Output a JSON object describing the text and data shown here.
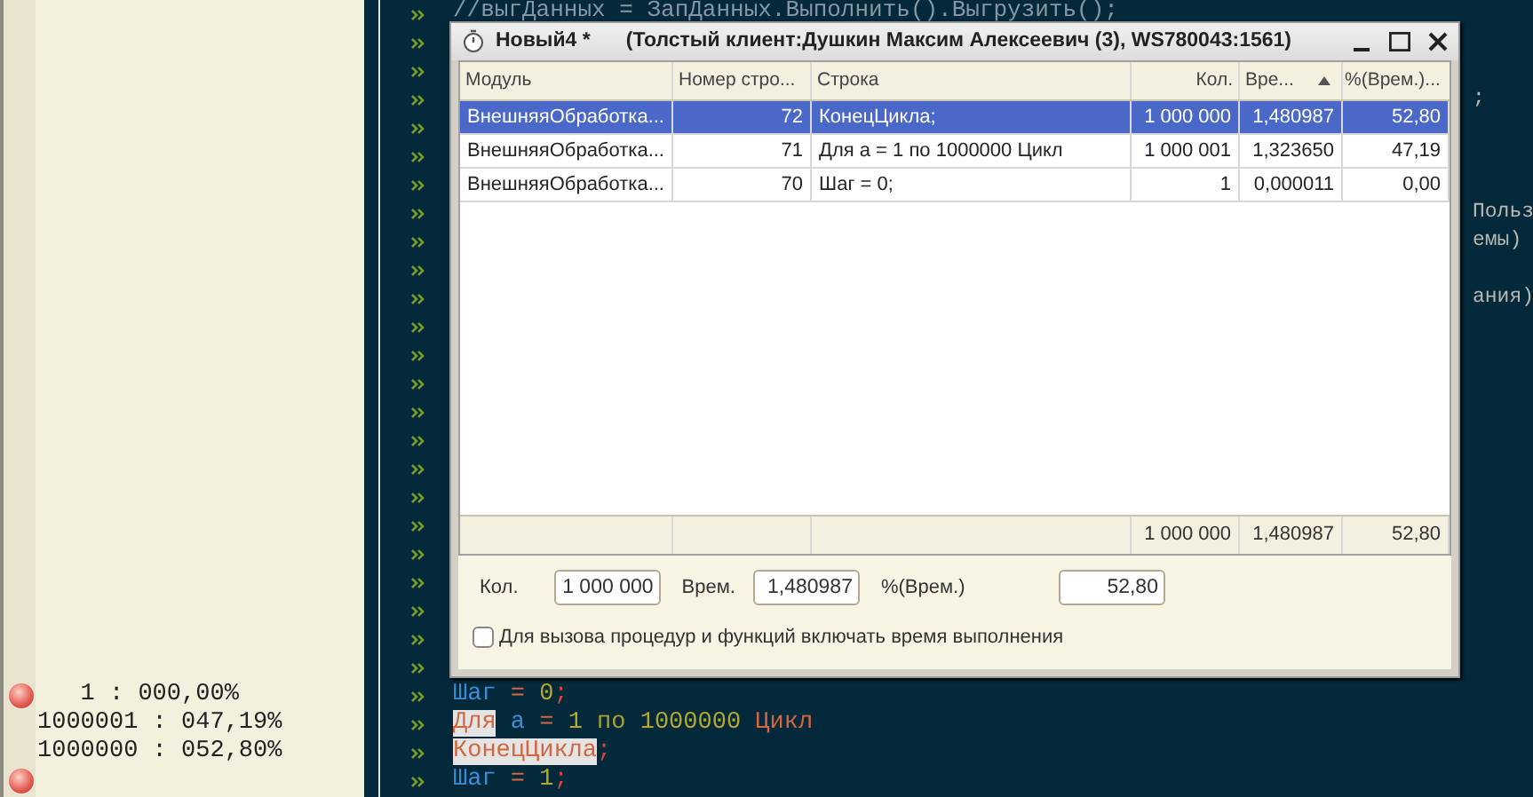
{
  "editor": {
    "lines": [
      {
        "breakpoint": false,
        "code": [
          {
            "text": "//выгДанных = ЗапДанных.Выполнить().Выгрузить();",
            "kind": "comment",
            "highlighted": false
          }
        ]
      },
      {
        "breakpoint": false
      },
      {
        "breakpoint": false
      },
      {
        "breakpoint": false,
        "tail": ";"
      },
      {
        "breakpoint": false
      },
      {
        "breakpoint": false
      },
      {
        "breakpoint": false
      },
      {
        "breakpoint": false,
        "tail": "Польз"
      },
      {
        "breakpoint": false,
        "tail": "емы)"
      },
      {
        "breakpoint": false
      },
      {
        "breakpoint": false,
        "tail": "ания)"
      },
      {
        "breakpoint": false
      },
      {
        "breakpoint": false
      },
      {
        "breakpoint": false
      },
      {
        "breakpoint": false
      },
      {
        "breakpoint": false
      },
      {
        "breakpoint": false
      },
      {
        "breakpoint": false
      },
      {
        "breakpoint": false
      },
      {
        "breakpoint": false
      },
      {
        "breakpoint": false
      },
      {
        "breakpoint": false
      },
      {
        "breakpoint": false
      },
      {
        "breakpoint": false
      },
      {
        "breakpoint": true,
        "gutter": "   1 : 000,00%",
        "code": [
          {
            "text": "Шаг",
            "kind": "identifier",
            "highlighted": false
          },
          {
            "text": " = ",
            "kind": "operator",
            "highlighted": false
          },
          {
            "text": "0",
            "kind": "number",
            "highlighted": false
          },
          {
            "text": ";",
            "kind": "punctuation",
            "highlighted": false
          }
        ]
      },
      {
        "breakpoint": false,
        "gutter": "1000001 : 047,19%",
        "code": [
          {
            "text": "Для",
            "kind": "keyword",
            "highlighted": true
          },
          {
            "text": " а",
            "kind": "identifier",
            "highlighted": false
          },
          {
            "text": " = ",
            "kind": "operator",
            "highlighted": false
          },
          {
            "text": "1 ",
            "kind": "number",
            "highlighted": false
          },
          {
            "text": "по ",
            "kind": "keyword_minor",
            "highlighted": false
          },
          {
            "text": "1000000 ",
            "kind": "number",
            "highlighted": false
          },
          {
            "text": "Цикл",
            "kind": "keyword",
            "highlighted": false
          }
        ]
      },
      {
        "breakpoint": false,
        "gutter": "1000000 : 052,80%",
        "code": [
          {
            "text": "КонецЦикла",
            "kind": "keyword",
            "highlighted": true
          },
          {
            "text": ";",
            "kind": "punctuation",
            "highlighted": false
          }
        ]
      },
      {
        "breakpoint": true,
        "code": [
          {
            "text": "Шаг",
            "kind": "identifier",
            "highlighted": false
          },
          {
            "text": " = ",
            "kind": "operator",
            "highlighted": false
          },
          {
            "text": "1",
            "kind": "number",
            "highlighted": false
          },
          {
            "text": ";",
            "kind": "punctuation",
            "highlighted": false
          }
        ]
      }
    ]
  },
  "window": {
    "title": "Новый4 *",
    "subtitle": "(Толстый клиент:Душкин Максим Алексеевич (3), WS780043:1561)",
    "table": {
      "columns": [
        {
          "label": "Модуль",
          "sorted": false
        },
        {
          "label": "Номер стро...",
          "sorted": false
        },
        {
          "label": "Строка",
          "sorted": false
        },
        {
          "label": "Кол.",
          "sorted": false
        },
        {
          "label": "Вре...",
          "sorted": true
        },
        {
          "label": "%(Врем.)...",
          "sorted": false
        }
      ],
      "rows": [
        {
          "selected": true,
          "cells": [
            "ВнешняяОбработка...",
            "72",
            "КонецЦикла;",
            "1 000 000",
            "1,480987",
            "52,80"
          ]
        },
        {
          "selected": false,
          "cells": [
            "ВнешняяОбработка...",
            "71",
            "Для а = 1 по 1000000 Цикл",
            "1 000 001",
            "1,323650",
            "47,19"
          ]
        },
        {
          "selected": false,
          "cells": [
            "ВнешняяОбработка...",
            "70",
            "Шаг = 0;",
            "1",
            "0,000011",
            "0,00"
          ]
        }
      ],
      "totals": [
        "1 000 000",
        "1,480987",
        "52,80"
      ]
    },
    "fields": [
      {
        "label": "Кол.",
        "value": "1 000 000"
      },
      {
        "label": "Врем.",
        "value": "1,480987"
      },
      {
        "label": "%(Врем.)",
        "value": "52,80"
      }
    ],
    "checkbox": {
      "label": "Для вызова процедур и функций включать время выполнения",
      "checked": false
    }
  }
}
